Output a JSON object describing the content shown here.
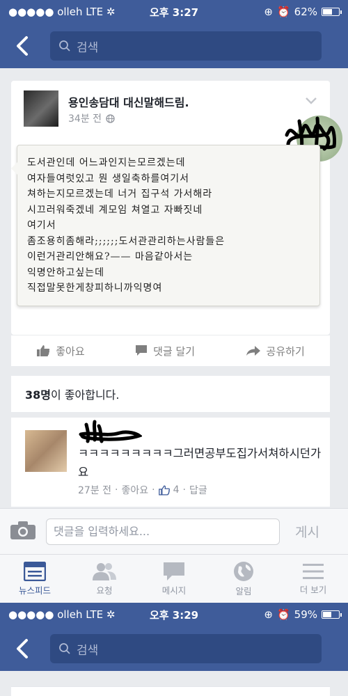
{
  "status_bar_1": {
    "carrier": "●●●●● olleh  LTE ✲",
    "time": "오후 3:27",
    "battery": "62%",
    "battery_level": 0.62
  },
  "nav": {
    "search_placeholder": "검색"
  },
  "post": {
    "author": "용인송담대 대신말해드림.",
    "time": "34분 전",
    "note_lines": [
      "도서관인데 어느과인지는모르겠는데",
      "여자들여럿있고 뭔 생일축하를여기서",
      "쳐하는지모르겠는데 너거 집구석 가서해라",
      "시끄러워죽겠네 계모임 쳐열고 자빠짓네",
      "여기서",
      "좀조용히좀해라;;;;;;도서관관리하는사람들은",
      "이런거관리안해요?—— 마음같아서는",
      "익명안하고싶는데",
      "직접말못한게창피하니까익명여"
    ]
  },
  "actions": {
    "like": "좋아요",
    "comment": "댓글 달기",
    "share": "공유하기"
  },
  "likes": {
    "count": "38명",
    "suffix": "이 좋아합니다."
  },
  "comment": {
    "text": "ㅋㅋㅋㅋㅋㅋㅋㅋㅋ그러면공부도집가서쳐하시던가요",
    "time": "27분 전",
    "like_link": "좋아요",
    "like_count": "4",
    "reply": "답글"
  },
  "composer": {
    "placeholder": "댓글을 입력하세요...",
    "post_label": "게시"
  },
  "tabs": [
    {
      "label": "뉴스피드",
      "icon": "news-feed-icon"
    },
    {
      "label": "요청",
      "icon": "friend-requests-icon"
    },
    {
      "label": "메시지",
      "icon": "messages-icon"
    },
    {
      "label": "알림",
      "icon": "globe-notifications-icon"
    },
    {
      "label": "더 보기",
      "icon": "menu-icon"
    }
  ],
  "status_bar_2": {
    "carrier": "●●●●● olleh  LTE ✲",
    "time": "오후 3:29",
    "battery": "59%",
    "battery_level": 0.59
  },
  "colors": {
    "brand": "#3f5c9a",
    "link_blue": "#3b5998",
    "muted": "#90949c"
  }
}
